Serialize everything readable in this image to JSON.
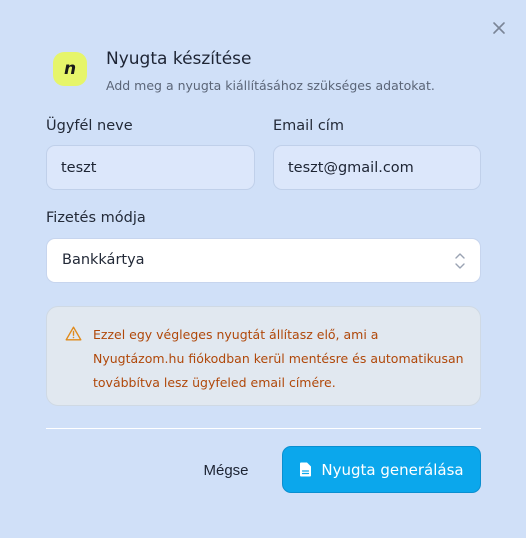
{
  "dialog": {
    "logo_letter": "n",
    "title": "Nyugta készítése",
    "subtitle": "Add meg a nyugta kiállításához szükséges adatokat.",
    "close_icon": "close-icon"
  },
  "form": {
    "customer_name": {
      "label": "Ügyfél neve",
      "value": "teszt"
    },
    "email": {
      "label": "Email cím",
      "value": "teszt@gmail.com"
    },
    "payment_method": {
      "label": "Fizetés módja",
      "value": "Bankkártya"
    }
  },
  "alert": {
    "icon": "warning-icon",
    "text": "Ezzel egy végleges nyugtát állítasz elő, ami a Nyugtázom.hu fiókodban kerül mentésre és automatikusan továbbítva lesz ügyfeled email címére."
  },
  "footer": {
    "cancel_label": "Mégse",
    "submit_label": "Nyugta generálása",
    "submit_icon": "document-icon"
  },
  "colors": {
    "background": "#d0e0f8",
    "accent": "#0ba7ec",
    "logo": "#e6f56a",
    "warning_text": "#b0480a"
  }
}
